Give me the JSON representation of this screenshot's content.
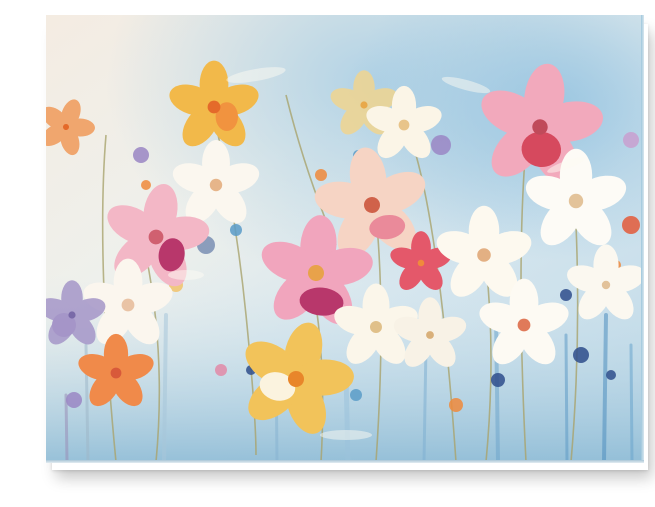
{
  "artwork": {
    "subject": "wildflowers-painting",
    "palette": {
      "sky_light": "#f3ede4",
      "sky_blue": "#a8cce3",
      "blue_deep": "#5a9cc8",
      "pink": "#e88aa3",
      "magenta": "#b8376b",
      "orange": "#f08a3c",
      "yellow": "#f2b94a",
      "white_petal": "#fbf7ef",
      "violet": "#9a86c4",
      "navy_bud": "#2f4e8c",
      "stem_green": "#a7a56a"
    }
  }
}
